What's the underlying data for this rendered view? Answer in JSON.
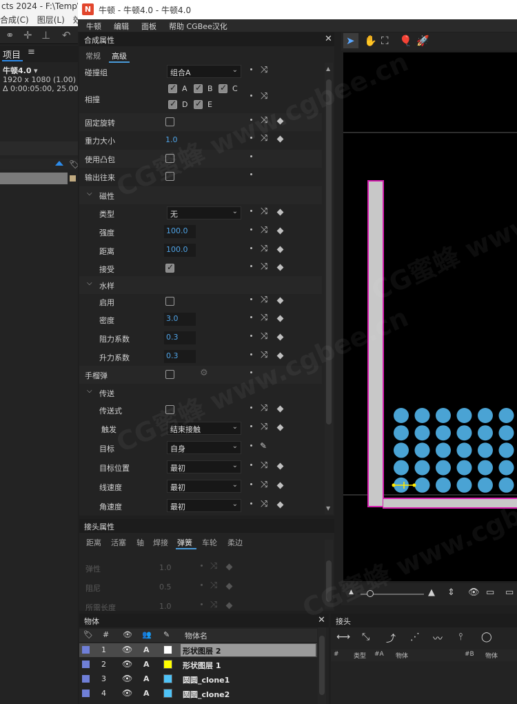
{
  "host": {
    "title": "cts 2024 - F:\\Temp\\",
    "menu": [
      "合成(C)",
      "图层(L)",
      "效"
    ],
    "project_tab": "项目",
    "comp_name": "牛顿4.0",
    "comp_res": "1920 x 1080 (1.00)",
    "comp_dur": "Δ 0:00:05:00, 25.00 fps"
  },
  "window": {
    "logo": "N",
    "title": "牛顿 - 牛顿4.0 - 牛顿4.0",
    "menu": [
      "牛顿",
      "编辑",
      "面板",
      "帮助 CGBee汉化"
    ]
  },
  "comp_panel": {
    "title": "合成属性",
    "tabs": [
      "常规",
      "高级"
    ],
    "rows": {
      "collision_group": {
        "label": "碰撞组",
        "value": "组合A"
      },
      "collide": {
        "label": "相撞",
        "options": [
          "A",
          "B",
          "C",
          "D",
          "E"
        ]
      },
      "fixed_rotation": {
        "label": "固定旋转"
      },
      "gravity_scale": {
        "label": "重力大小",
        "value": "1.0"
      },
      "use_convex": {
        "label": "使用凸包"
      },
      "export_back": {
        "label": "输出往来"
      },
      "magnet": {
        "label": "磁性",
        "type": {
          "label": "类型",
          "value": "无"
        },
        "strength": {
          "label": "强度",
          "value": "100.0"
        },
        "distance": {
          "label": "距离",
          "value": "100.0"
        },
        "accept": {
          "label": "接受"
        }
      },
      "water": {
        "label": "水样",
        "enable": {
          "label": "启用"
        },
        "density": {
          "label": "密度",
          "value": "3.0"
        },
        "drag": {
          "label": "阻力系数",
          "value": "0.3"
        },
        "lift": {
          "label": "升力系数",
          "value": "0.3"
        }
      },
      "grenade": {
        "label": "手榴弹"
      },
      "teleport": {
        "label": "传送",
        "teleporter": {
          "label": "传送式"
        },
        "trigger": {
          "label": "触发",
          "value": "结束接触"
        },
        "target": {
          "label": "目标",
          "value": "自身"
        },
        "target_pos": {
          "label": "目标位置",
          "value": "最初"
        },
        "linear_vel": {
          "label": "线速度",
          "value": "最初"
        },
        "angular_vel": {
          "label": "角速度",
          "value": "最初"
        }
      }
    }
  },
  "joint_panel": {
    "title": "接头属性",
    "tabs": [
      "距离",
      "活塞",
      "轴",
      "焊接",
      "弹簧",
      "车轮",
      "柔边"
    ],
    "fields": [
      {
        "label": "弹性",
        "value": "1.0"
      },
      {
        "label": "阻尼",
        "value": "0.5"
      },
      {
        "label": "所需长度",
        "value": "1.0"
      }
    ]
  },
  "objects_panel": {
    "title": "物体",
    "headers": {
      "num": "#",
      "name": "物体名"
    },
    "rows": [
      {
        "num": "1",
        "name": "形状图层 2",
        "color": "#ffffff",
        "selected": true
      },
      {
        "num": "2",
        "name": "形状图层 1",
        "color": "#ffff00",
        "selected": false
      },
      {
        "num": "3",
        "name": "圆圆_clone1",
        "color": "#4fc3f7",
        "selected": false
      },
      {
        "num": "4",
        "name": "圆圆_clone2",
        "color": "#4fc3f7",
        "selected": false
      }
    ],
    "flag": "A"
  },
  "joints_panel": {
    "title": "接头",
    "headers": [
      "#",
      "类型",
      "#A",
      "物体",
      "#B",
      "物体"
    ]
  },
  "watermark": "CG蜜蜂 www.cgbee.cn",
  "colors": {
    "accent": "#4a9cdb",
    "value": "#4fa3e6",
    "ball": "#4aa3d4",
    "wall": "#c8c8c8",
    "wall_border": "#d61fb0"
  }
}
